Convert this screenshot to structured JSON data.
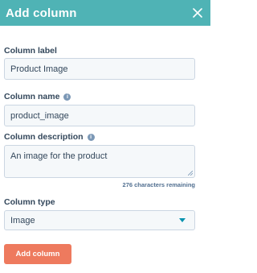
{
  "dialog": {
    "title": "Add column",
    "close_icon": "close-icon"
  },
  "form": {
    "label_field": {
      "label": "Column label",
      "value": "Product Image"
    },
    "name_field": {
      "label": "Column name",
      "value": "product_image",
      "info_icon": "info-icon"
    },
    "description_field": {
      "label": "Column description",
      "value": "An image for the product",
      "info_icon": "info-icon",
      "remaining": "276 characters remaining"
    },
    "type_field": {
      "label": "Column type",
      "selected": "Image"
    },
    "submit_label": "Add column"
  },
  "colors": {
    "header": "#4fb3b5",
    "primary_button": "#ee7a5e",
    "caret": "#0091ae"
  }
}
